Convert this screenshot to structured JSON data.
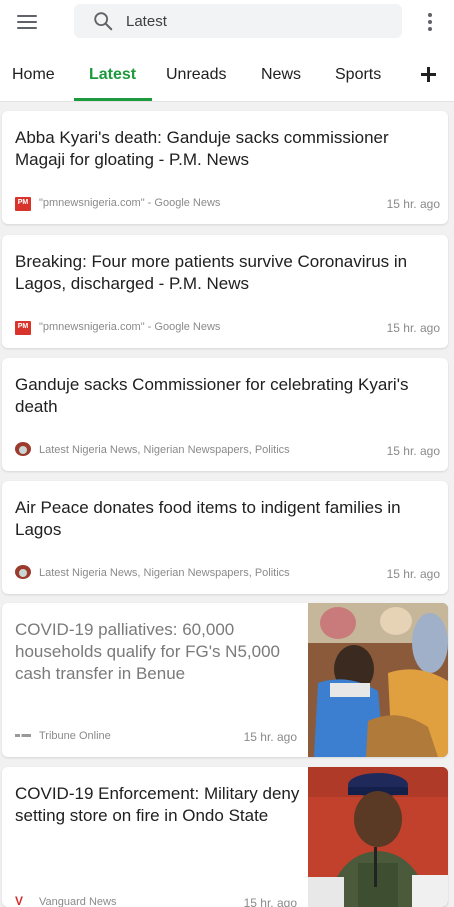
{
  "search": {
    "value": "Latest"
  },
  "tabs": [
    {
      "label": "Home"
    },
    {
      "label": "Latest"
    },
    {
      "label": "Unreads"
    },
    {
      "label": "News"
    },
    {
      "label": "Sports"
    }
  ],
  "articles": [
    {
      "headline": "Abba Kyari's death: Ganduje sacks commissioner Magaji for gloating - P.M. News",
      "source": "\"pmnewsnigeria.com\" - Google News",
      "time": "15 hr. ago",
      "logo_text": "PM"
    },
    {
      "headline": "Breaking: Four more patients survive Coronavirus in Lagos, discharged - P.M. News",
      "source": "\"pmnewsnigeria.com\" - Google News",
      "time": "15 hr. ago",
      "logo_text": "PM"
    },
    {
      "headline": "Ganduje sacks Commissioner for celebrating Kyari's death",
      "source": "Latest Nigeria News, Nigerian Newspapers, Politics",
      "time": "15 hr. ago"
    },
    {
      "headline": "Air Peace donates food items to indigent families in Lagos",
      "source": "Latest Nigeria News, Nigerian Newspapers, Politics",
      "time": "15 hr. ago"
    },
    {
      "headline": "COVID-19 palliatives: 60,000 households qualify for FG's N5,000 cash transfer in  Benue",
      "source": "Tribune Online",
      "time": "15 hr. ago"
    },
    {
      "headline": "COVID-19 Enforcement: Military deny setting store on fire in Ondo State",
      "source": "Vanguard News",
      "time": "15 hr. ago"
    }
  ],
  "colors": {
    "accent": "#1e9a3e",
    "visited_text": "#7a7a7a"
  }
}
